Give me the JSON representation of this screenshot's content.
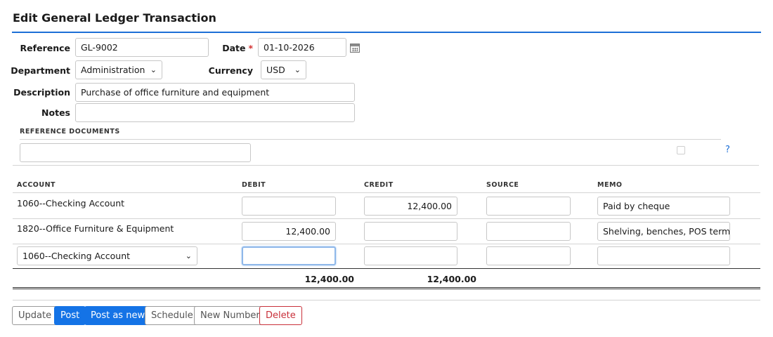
{
  "page_title": "Edit General Ledger Transaction",
  "form": {
    "reference_label": "Reference",
    "reference_value": "GL-9002",
    "date_label": "Date",
    "required_mark": "*",
    "date_value": "01-10-2026",
    "department_label": "Department",
    "department_value": "Administration",
    "currency_label": "Currency",
    "currency_value": "USD",
    "description_label": "Description",
    "description_value": "Purchase of office furniture and equipment",
    "notes_label": "Notes",
    "notes_value": ""
  },
  "reference_documents": {
    "heading": "REFERENCE DOCUMENTS",
    "input_value": "",
    "help_text": "?"
  },
  "table": {
    "headers": [
      "ACCOUNT",
      "DEBIT",
      "CREDIT",
      "SOURCE",
      "MEMO"
    ],
    "rows": [
      {
        "account": "1060--Checking Account",
        "debit": "",
        "credit": "12,400.00",
        "source": "",
        "memo": "Paid by cheque"
      },
      {
        "account": "1820--Office Furniture & Equipment",
        "debit": "12,400.00",
        "credit": "",
        "source": "",
        "memo": "Shelving, benches, POS terminal"
      },
      {
        "account": "1060--Checking Account",
        "debit": "",
        "credit": "",
        "source": "",
        "memo": ""
      }
    ],
    "total_debit": "12,400.00",
    "total_credit": "12,400.00"
  },
  "buttons": {
    "update": "Update",
    "post": "Post",
    "post_as_new": "Post as new",
    "schedule": "Schedule",
    "new_number": "New Number",
    "delete": "Delete"
  },
  "icons": {
    "calendar": "calendar-icon",
    "chevron": "chevron-down-icon"
  },
  "colors": {
    "accent": "#1473e6",
    "danger": "#c9303a",
    "required": "#d33131"
  }
}
